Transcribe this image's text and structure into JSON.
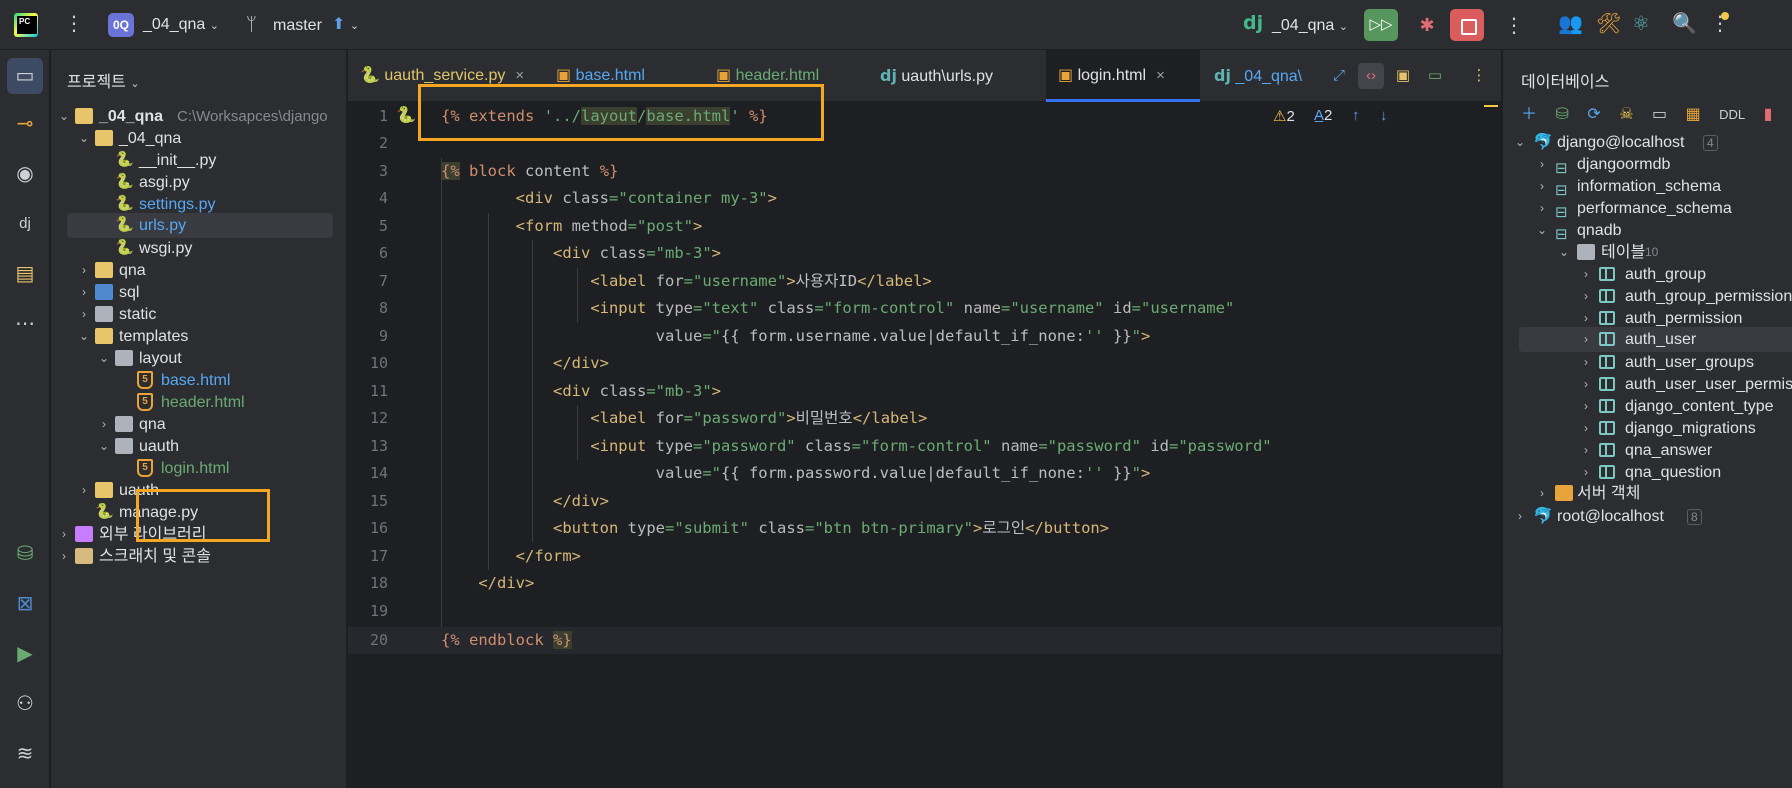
{
  "topbar": {
    "logo_text": "PC",
    "project_badge": "0Q",
    "project_name": "_04_qna",
    "branch": "master",
    "run_config": "_04_qna"
  },
  "project_panel": {
    "title": "프로젝트",
    "root_name": "_04_qna",
    "root_path": "C:\\Worksapces\\django",
    "items": [
      {
        "label": "_04_qna"
      },
      {
        "label": "__init__.py"
      },
      {
        "label": "asgi.py"
      },
      {
        "label": "settings.py"
      },
      {
        "label": "urls.py"
      },
      {
        "label": "wsgi.py"
      },
      {
        "label": "qna"
      },
      {
        "label": "sql"
      },
      {
        "label": "static"
      },
      {
        "label": "templates"
      },
      {
        "label": "layout"
      },
      {
        "label": "base.html"
      },
      {
        "label": "header.html"
      },
      {
        "label": "qna"
      },
      {
        "label": "uauth"
      },
      {
        "label": "login.html"
      },
      {
        "label": "uauth"
      },
      {
        "label": "manage.py"
      },
      {
        "label": "외부 라이브러리"
      },
      {
        "label": "스크래치 및 콘솔"
      }
    ]
  },
  "tabs": [
    {
      "label": "uauth_service.py",
      "close": "×"
    },
    {
      "label": "base.html"
    },
    {
      "label": "header.html"
    },
    {
      "label": "uauth\\urls.py"
    },
    {
      "label": "login.html",
      "close": "×"
    },
    {
      "label": "_04_qna\\"
    }
  ],
  "editor": {
    "inspections": {
      "warnings": "2",
      "typos": "2"
    },
    "line_numbers": [
      "1",
      "2",
      "3",
      "4",
      "5",
      "6",
      "7",
      "8",
      "9",
      "10",
      "11",
      "12",
      "13",
      "14",
      "15",
      "16",
      "17",
      "18",
      "19",
      "20"
    ]
  },
  "db_panel": {
    "title": "데이터베이스",
    "ddl_label": "DDL",
    "tree": [
      {
        "label": "django@localhost",
        "count": "4"
      },
      {
        "label": "djangoormdb"
      },
      {
        "label": "information_schema"
      },
      {
        "label": "performance_schema"
      },
      {
        "label": "qnadb"
      },
      {
        "label": "테이블",
        "count": "10"
      },
      {
        "label": "auth_group"
      },
      {
        "label": "auth_group_permissions"
      },
      {
        "label": "auth_permission"
      },
      {
        "label": "auth_user"
      },
      {
        "label": "auth_user_groups"
      },
      {
        "label": "auth_user_user_permissions"
      },
      {
        "label": "django_content_type"
      },
      {
        "label": "django_migrations"
      },
      {
        "label": "qna_answer"
      },
      {
        "label": "qna_question"
      },
      {
        "label": "서버 객체"
      },
      {
        "label": "root@localhost",
        "count": "8"
      }
    ]
  },
  "colors": {
    "accent": "#3574f0",
    "highlight_box": "#f5a623",
    "run_button": "#57965c",
    "stop_button": "#db5c5c"
  }
}
